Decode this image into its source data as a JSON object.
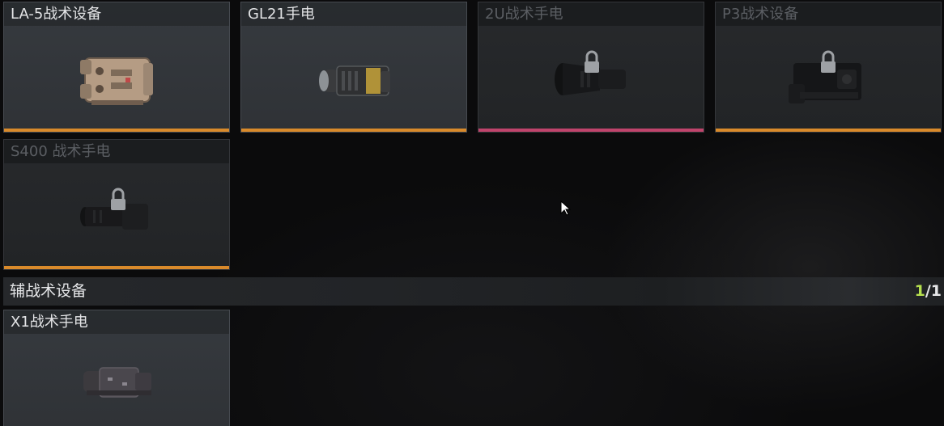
{
  "slots": [
    {
      "name": "LA-5战术设备",
      "icon": "la5-laser-module-icon",
      "rarity_color": "#d98a2b",
      "locked": false
    },
    {
      "name": "GL21手电",
      "icon": "gl21-flashlight-icon",
      "rarity_color": "#d98a2b",
      "locked": false
    },
    {
      "name": "2U战术手电",
      "icon": "2u-flashlight-icon",
      "rarity_color": "#c0446c",
      "locked": true
    },
    {
      "name": "P3战术设备",
      "icon": "p3-tactical-device-icon",
      "rarity_color": "#d98a2b",
      "locked": true
    },
    {
      "name": "S400 战术手电",
      "icon": "s400-flashlight-icon",
      "rarity_color": "#d98a2b",
      "locked": true
    }
  ],
  "section": {
    "title": "辅战术设备",
    "count_current": "1",
    "count_sep": "/",
    "count_total": "1"
  },
  "sub_slots": [
    {
      "name": "X1战术手电",
      "icon": "x1-flashlight-icon",
      "locked": false
    }
  ],
  "colors": {
    "rarity_orange": "#d98a2b",
    "rarity_pink": "#c0446c",
    "count_highlight": "#b6e04e"
  }
}
